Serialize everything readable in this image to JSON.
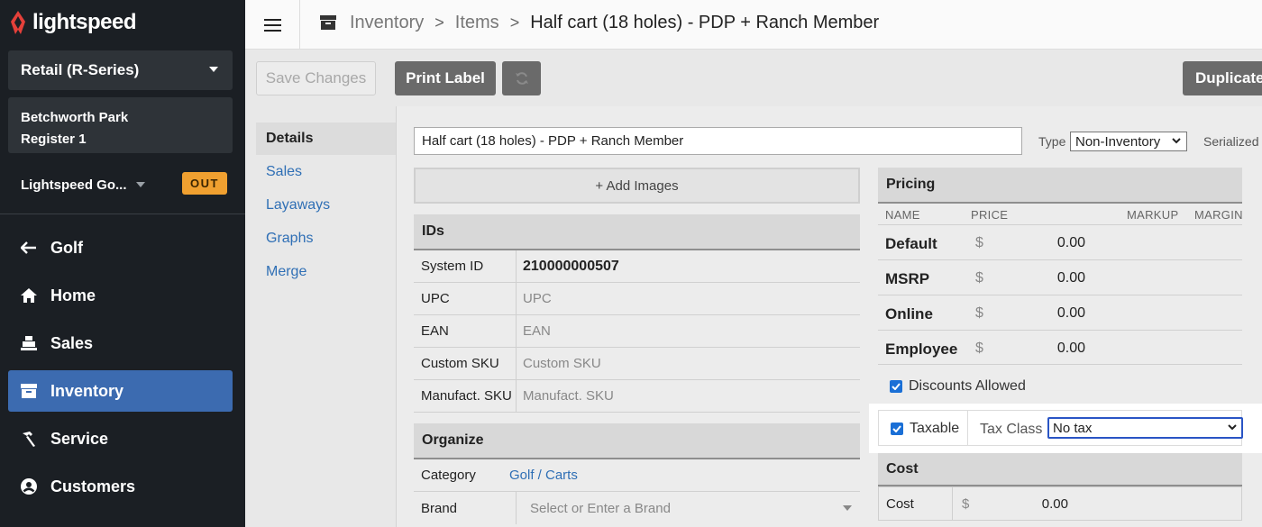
{
  "app": {
    "brand": "lightspeed"
  },
  "sidebar": {
    "account": "Retail (R-Series)",
    "shop": "Betchworth Park",
    "register": "Register 1",
    "user": "Lightspeed Go...",
    "user_status": "OUT",
    "nav": [
      {
        "label": "Golf",
        "icon": "arrow-left-icon"
      },
      {
        "label": "Home",
        "icon": "home-icon"
      },
      {
        "label": "Sales",
        "icon": "register-icon"
      },
      {
        "label": "Inventory",
        "icon": "inventory-box-icon",
        "active": true
      },
      {
        "label": "Service",
        "icon": "hammer-icon"
      },
      {
        "label": "Customers",
        "icon": "user-circle-icon"
      }
    ]
  },
  "breadcrumb": {
    "root": "Inventory",
    "section": "Items",
    "current": "Half cart (18 holes) - PDP + Ranch Member"
  },
  "toolbar": {
    "save": "Save Changes",
    "print": "Print Label",
    "duplicate": "Duplicate"
  },
  "subnav": [
    "Details",
    "Sales",
    "Layaways",
    "Graphs",
    "Merge"
  ],
  "item": {
    "name": "Half cart (18 holes) - PDP + Ranch Member",
    "type_label": "Type",
    "type_value": "Non-Inventory",
    "serialized_label": "Serialized",
    "add_images": "+ Add Images"
  },
  "ids": {
    "title": "IDs",
    "rows": [
      {
        "label": "System ID",
        "value": "210000000507"
      },
      {
        "label": "UPC",
        "placeholder": "UPC"
      },
      {
        "label": "EAN",
        "placeholder": "EAN"
      },
      {
        "label": "Custom SKU",
        "placeholder": "Custom SKU"
      },
      {
        "label": "Manufact. SKU",
        "placeholder": "Manufact. SKU"
      }
    ]
  },
  "organize": {
    "title": "Organize",
    "category_label": "Category",
    "category_value": "Golf / Carts",
    "brand_label": "Brand",
    "brand_placeholder": "Select or Enter a Brand"
  },
  "pricing": {
    "title": "Pricing",
    "columns": {
      "name": "NAME",
      "price": "PRICE",
      "markup": "MARKUP",
      "margin": "MARGIN"
    },
    "currency": "$",
    "rows": [
      {
        "name": "Default",
        "price": "0.00"
      },
      {
        "name": "MSRP",
        "price": "0.00"
      },
      {
        "name": "Online",
        "price": "0.00"
      },
      {
        "name": "Employee",
        "price": "0.00"
      }
    ],
    "discounts_allowed": "Discounts Allowed",
    "taxable": "Taxable",
    "tax_class_label": "Tax Class",
    "tax_class_value": "No tax"
  },
  "cost": {
    "title": "Cost",
    "label": "Cost",
    "currency": "$",
    "value": "0.00"
  },
  "colors": {
    "sidebar_bg": "#1b1f24",
    "active_nav": "#3c6bb0",
    "badge": "#f0a030",
    "link": "#2f6fb5"
  }
}
